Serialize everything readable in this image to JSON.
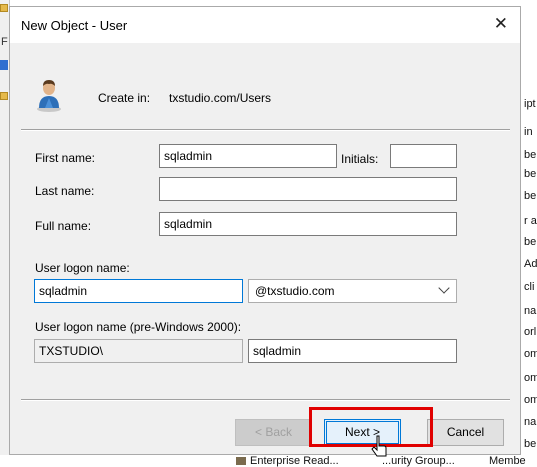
{
  "background": {
    "right_snippets": [
      "ipt",
      "in",
      "be",
      "be",
      "be",
      "r a",
      "be",
      "Ad",
      "cli",
      "na",
      "orl",
      "om",
      "om",
      "om",
      "na",
      "be"
    ],
    "left_stray": [
      "F"
    ],
    "bottom_row": {
      "name": "Enterprise Read...",
      "type": "...urity Group...",
      "desc": "Membe"
    }
  },
  "dialog": {
    "title": "New Object - User",
    "close_glyph": "✕",
    "create_in_label": "Create in:",
    "create_in_value": "txstudio.com/Users",
    "first_name": {
      "label": "First name:",
      "value": "sqladmin"
    },
    "initials": {
      "label": "Initials:",
      "value": ""
    },
    "last_name": {
      "label": "Last name:",
      "value": ""
    },
    "full_name": {
      "label": "Full name:",
      "value": "sqladmin"
    },
    "logon_name": {
      "label": "User logon name:",
      "value": "sqladmin"
    },
    "upn_suffix": {
      "selected": "@txstudio.com"
    },
    "pre2000": {
      "label": "User logon name (pre-Windows 2000):",
      "domain": "TXSTUDIO\\",
      "value": "sqladmin"
    },
    "buttons": {
      "back": "< Back",
      "next": "Next >",
      "cancel": "Cancel"
    }
  },
  "colors": {
    "accent": "#0078d7",
    "highlight": "#e00000",
    "dialog_bg": "#f0f0f0"
  },
  "icons": {
    "user": "user-icon",
    "close": "close-icon",
    "chevron": "chevron-down-icon",
    "cursor": "pointer-cursor-icon"
  }
}
